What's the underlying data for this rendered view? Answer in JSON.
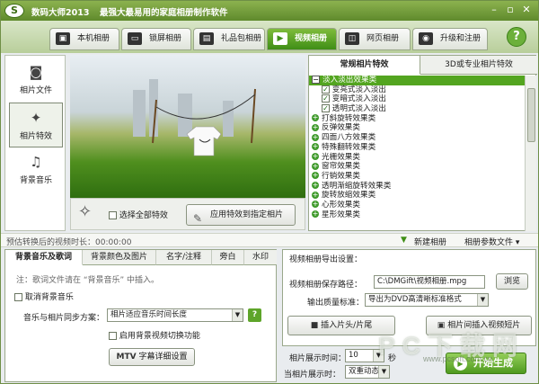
{
  "app": {
    "title": "数码大师2013",
    "slogan": "最强大最易用的家庭相册制作软件"
  },
  "tabs": [
    {
      "label": "本机相册",
      "icon": "local-album-icon"
    },
    {
      "label": "锁屏相册",
      "icon": "monitor-icon"
    },
    {
      "label": "礼品包相册",
      "icon": "gift-icon"
    },
    {
      "label": "视频相册",
      "icon": "video-icon"
    },
    {
      "label": "网页相册",
      "icon": "web-icon"
    },
    {
      "label": "升级和注册",
      "icon": "globe-icon"
    }
  ],
  "help_label": "?",
  "leftnav": [
    {
      "label": "相片文件",
      "icon": "camera-icon"
    },
    {
      "label": "相片特效",
      "icon": "effect-icon"
    },
    {
      "label": "背景音乐",
      "icon": "music-icon"
    }
  ],
  "preview_controls": {
    "select_all": "选择全部特效",
    "apply": "应用特效到指定相片"
  },
  "effects_tabs": [
    "常规相片特效",
    "3D或专业相片特效"
  ],
  "effects_tree": [
    {
      "label": "淡入淡出效果类",
      "type": "group",
      "expanded": true,
      "selected": true
    },
    {
      "label": "变亮式淡入淡出",
      "type": "item",
      "checked": true
    },
    {
      "label": "变暗式淡入淡出",
      "type": "item",
      "checked": true
    },
    {
      "label": "透明式淡入淡出",
      "type": "item",
      "checked": true
    },
    {
      "label": "打斜旋转效果类",
      "type": "group"
    },
    {
      "label": "反弹效果类",
      "type": "group"
    },
    {
      "label": "四面八方效果类",
      "type": "group"
    },
    {
      "label": "特殊翻转效果类",
      "type": "group"
    },
    {
      "label": "光栅效果类",
      "type": "group"
    },
    {
      "label": "窗帘效果类",
      "type": "group"
    },
    {
      "label": "行销效果类",
      "type": "group"
    },
    {
      "label": "透明渐缩旋转效果类",
      "type": "group"
    },
    {
      "label": "旋转放缩效果类",
      "type": "group"
    },
    {
      "label": "心形效果类",
      "type": "group"
    },
    {
      "label": "星形效果类",
      "type": "group"
    }
  ],
  "status": {
    "estimate": "预估转换后的视频时长：00:00:00",
    "new_album": "新建相册",
    "album_file": "相册参数文件 ▾"
  },
  "bottom_tabs": [
    "背景音乐及歌词",
    "背景颜色及图片",
    "名字/注释",
    "旁白",
    "水印"
  ],
  "music_panel": {
    "note": "注：歌词文件请在 “背景音乐” 中插入。",
    "cancel_bg_music": "取消背景音乐",
    "sync_label": "音乐与相片同步方案：",
    "sync_value": "相片适应音乐时间长度",
    "enable_switch": "启用背景视频切换功能",
    "mtv_label": "MTV",
    "subtitle_btn": "字幕详细设置"
  },
  "export_panel": {
    "title": "视频相册导出设置：",
    "path_label": "视频相册保存路径：",
    "path_value": "C:\\DMGift\\视频相册.mpg",
    "browse": "浏览",
    "quality_label": "输出质量标准：",
    "quality_value": "导出为DVD高清晰标准格式",
    "insert_head": "插入片头/片尾",
    "insert_clip": "相片间插入视频短片",
    "duration_label": "相片展示时间：",
    "duration_value": "10",
    "duration_unit": "秒",
    "display_label": "当相片展示时：",
    "display_value": "双重动态"
  },
  "start_btn": "开始生成",
  "watermark": "PC下载网",
  "watermark_url": "www.pcsoft.com.cn",
  "colors": {
    "accent": "#5f8a2c",
    "active_tab": "#3f8e16",
    "selection": "#53a520"
  }
}
